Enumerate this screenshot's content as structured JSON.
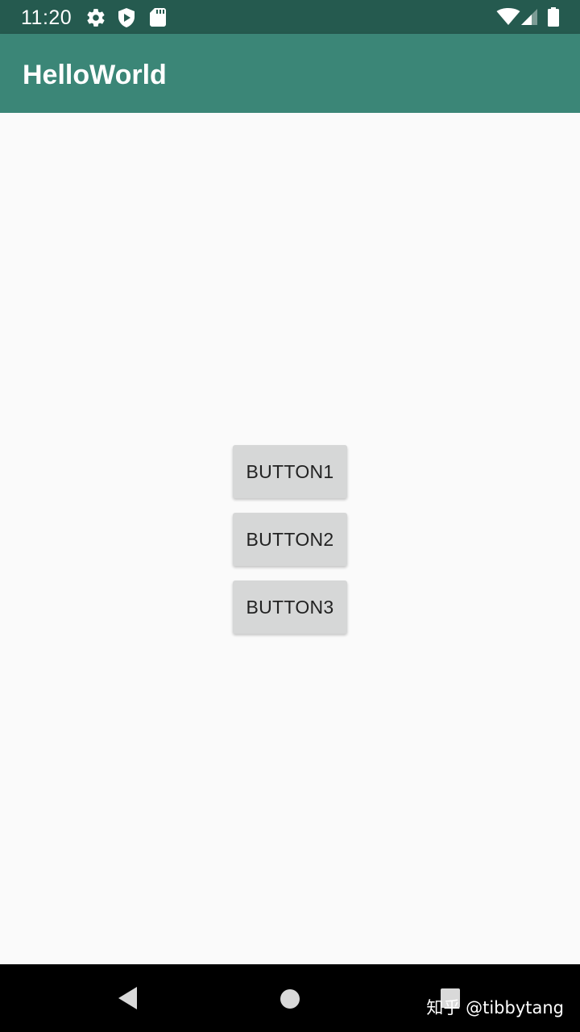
{
  "status_bar": {
    "time": "11:20",
    "icons": [
      "gear-icon",
      "play-shield-icon",
      "sd-card-icon",
      "wifi-icon",
      "signal-icon",
      "battery-icon"
    ],
    "background": "#255a4f"
  },
  "app_bar": {
    "title": "HelloWorld",
    "background": "#3b8677"
  },
  "main": {
    "buttons": [
      {
        "label": "BUTTON1"
      },
      {
        "label": "BUTTON2"
      },
      {
        "label": "BUTTON3"
      }
    ],
    "button_color": "#d6d7d7"
  },
  "nav_bar": {
    "icons": [
      "back-icon",
      "home-icon",
      "recents-icon"
    ],
    "watermark": "知乎 @tibbytang"
  }
}
